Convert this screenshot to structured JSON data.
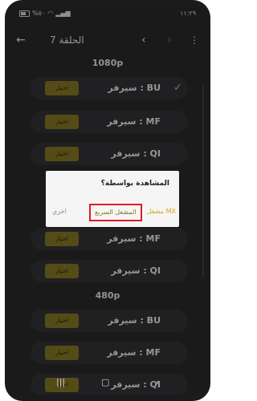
{
  "status": {
    "time": "١١:٢٩",
    "left_text": "%٥٠"
  },
  "toolbar": {
    "title": "الحلقة 7",
    "back_icon": "arrow-back-icon",
    "menu_icon": "more-vert-icon"
  },
  "sections": [
    {
      "name": "1080p"
    },
    {
      "name": "480p"
    }
  ],
  "rows_1080": [
    {
      "label": "سيرفر : BU",
      "choose": "اختيار",
      "checked": true
    },
    {
      "label": "سيرفر : MF",
      "choose": "اختيار"
    },
    {
      "label": "سيرفر : QI",
      "choose": "اختيار"
    }
  ],
  "rows_720": [
    {
      "label": "سيرفر : MF",
      "choose": "اختيار"
    },
    {
      "label": "سيرفر : QI",
      "choose": "اختيار"
    }
  ],
  "rows_480": [
    {
      "label": "سيرفر : BU",
      "choose": "اختيار"
    },
    {
      "label": "سيرفر : MF",
      "choose": "اختيار"
    },
    {
      "label": "سيرفر : QI",
      "choose": "اختيار"
    }
  ],
  "dialog": {
    "question": "المشاهدة بواسطة؟",
    "mx_label": "مشغل MX",
    "fast_label": "المشغل السريع",
    "other_label": "اخري"
  },
  "colors": {
    "accent": "#d4a41c",
    "highlight_border": "#e01a24",
    "choose_bg": "#8a7a26"
  }
}
